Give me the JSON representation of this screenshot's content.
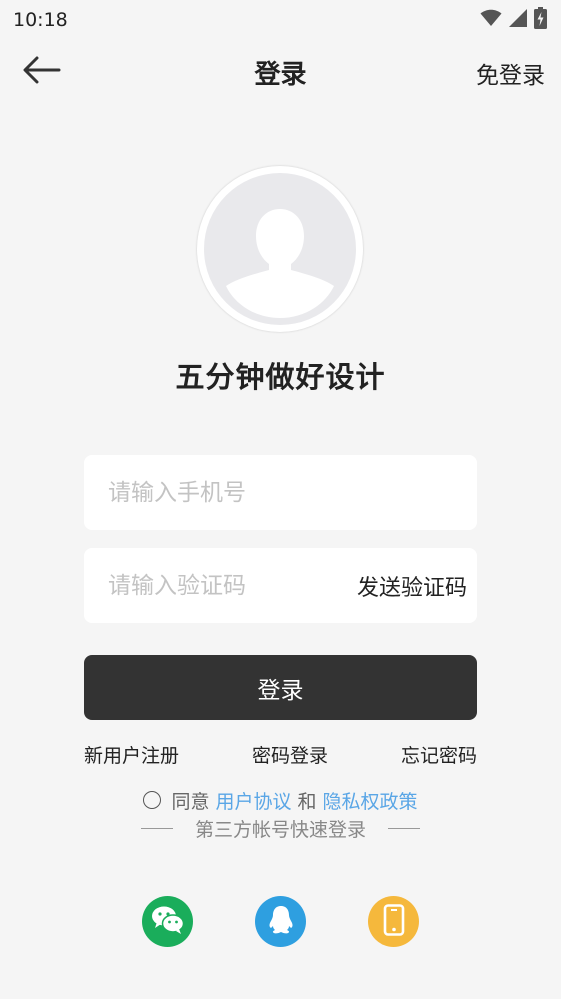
{
  "status_bar": {
    "time": "10:18",
    "icons": [
      "wifi-icon",
      "signal-icon",
      "battery-charging-icon"
    ]
  },
  "nav": {
    "back_icon": "arrow-left-icon",
    "title": "登录",
    "skip_label": "免登录"
  },
  "profile": {
    "avatar_icon": "user-silhouette-icon",
    "slogan": "五分钟做好设计"
  },
  "form": {
    "phone_placeholder": "请输入手机号",
    "phone_value": "",
    "code_placeholder": "请输入验证码",
    "code_value": "",
    "send_code_label": "发送验证码",
    "login_label": "登录"
  },
  "links": {
    "register": "新用户注册",
    "password_login": "密码登录",
    "forgot_password": "忘记密码"
  },
  "agreement": {
    "prefix": "同意",
    "user_agreement": "用户协议",
    "conjunction": "和",
    "privacy_policy": "隐私权政策",
    "link_color": "#5aa6e6"
  },
  "third_party": {
    "label": "第三方帐号快速登录",
    "providers": [
      {
        "icon": "wechat-icon",
        "color": "#1aad5b"
      },
      {
        "icon": "qq-icon",
        "color": "#2e9fe0"
      },
      {
        "icon": "mobile-phone-icon",
        "color": "#f5b83c"
      }
    ]
  },
  "colors": {
    "background": "#f5f5f5",
    "primary_button": "#333333"
  }
}
